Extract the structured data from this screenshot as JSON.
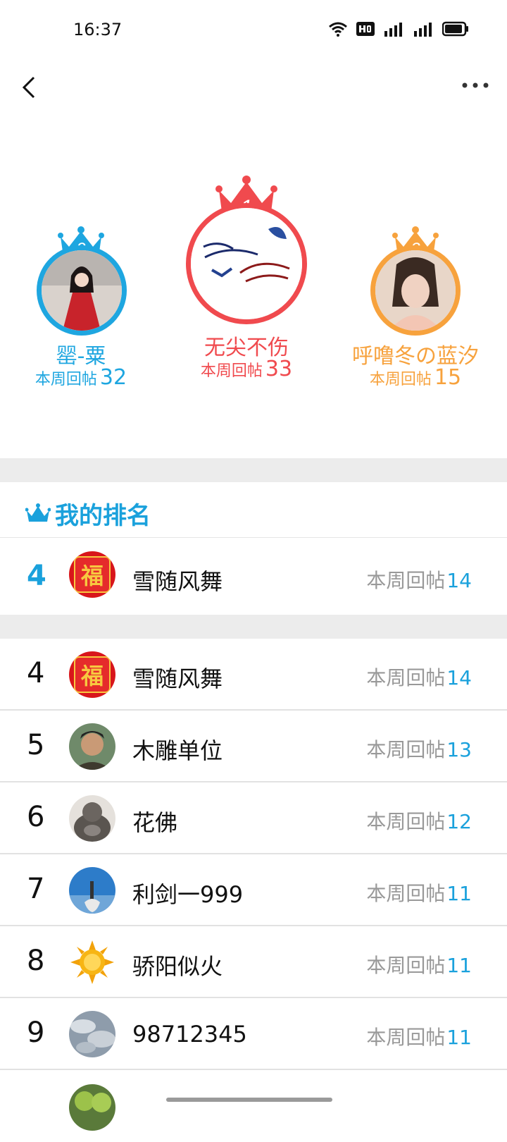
{
  "status": {
    "time": "16:37"
  },
  "podium": [
    {
      "place": "2",
      "name": "罂-粟",
      "label": "本周回帖",
      "count": "32",
      "color": "#1ea6e0"
    },
    {
      "place": "1",
      "name": "无尖不伤",
      "label": "本周回帖",
      "count": "33",
      "color": "#f04a4e"
    },
    {
      "place": "3",
      "name": "呼噜冬の蓝汐",
      "label": "本周回帖",
      "count": "15",
      "color": "#f7a23d"
    }
  ],
  "my_rank": {
    "title": "我的排名",
    "rank": "4",
    "name": "雪随风舞",
    "label": "本周回帖",
    "count": "14"
  },
  "list": [
    {
      "rank": "4",
      "name": "雪随风舞",
      "label": "本周回帖",
      "count": "14"
    },
    {
      "rank": "5",
      "name": "木雕单位",
      "label": "本周回帖",
      "count": "13"
    },
    {
      "rank": "6",
      "name": "花佛",
      "label": "本周回帖",
      "count": "12"
    },
    {
      "rank": "7",
      "name": "利剑一999",
      "label": "本周回帖",
      "count": "11"
    },
    {
      "rank": "8",
      "name": "骄阳似火",
      "label": "本周回帖",
      "count": "11"
    },
    {
      "rank": "9",
      "name": "98712345",
      "label": "本周回帖",
      "count": "11"
    }
  ],
  "colors": {
    "accent": "#1aa1dc",
    "divider": "#ececec"
  }
}
